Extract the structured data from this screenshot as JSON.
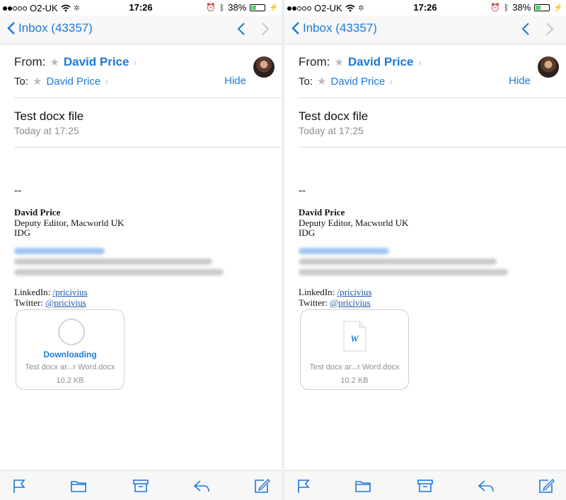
{
  "status_bar": {
    "carrier": "O2-UK",
    "time": "17:26",
    "battery": "38%"
  },
  "nav": {
    "back_label": "Inbox (43357)"
  },
  "message": {
    "from_label": "From:",
    "from_name": "David Price",
    "to_label": "To:",
    "to_name": "David Price",
    "hide_label": "Hide",
    "subject": "Test docx file",
    "date": "Today at 17:25"
  },
  "signature": {
    "dashes": "--",
    "name": "David Price",
    "title": "Deputy Editor, Macworld UK",
    "company": "IDG",
    "linkedin_label": "LinkedIn:",
    "linkedin_link": "/pricivius",
    "twitter_label": "Twitter:",
    "twitter_link": "@pricivius"
  },
  "attachment": {
    "left_status": "Downloading",
    "name": "Test docx ar...r Word.docx",
    "size": "10.2 KB",
    "word_letter": "W"
  },
  "colors": {
    "accent": "#1c7ad9",
    "battery": "#4cd964"
  }
}
